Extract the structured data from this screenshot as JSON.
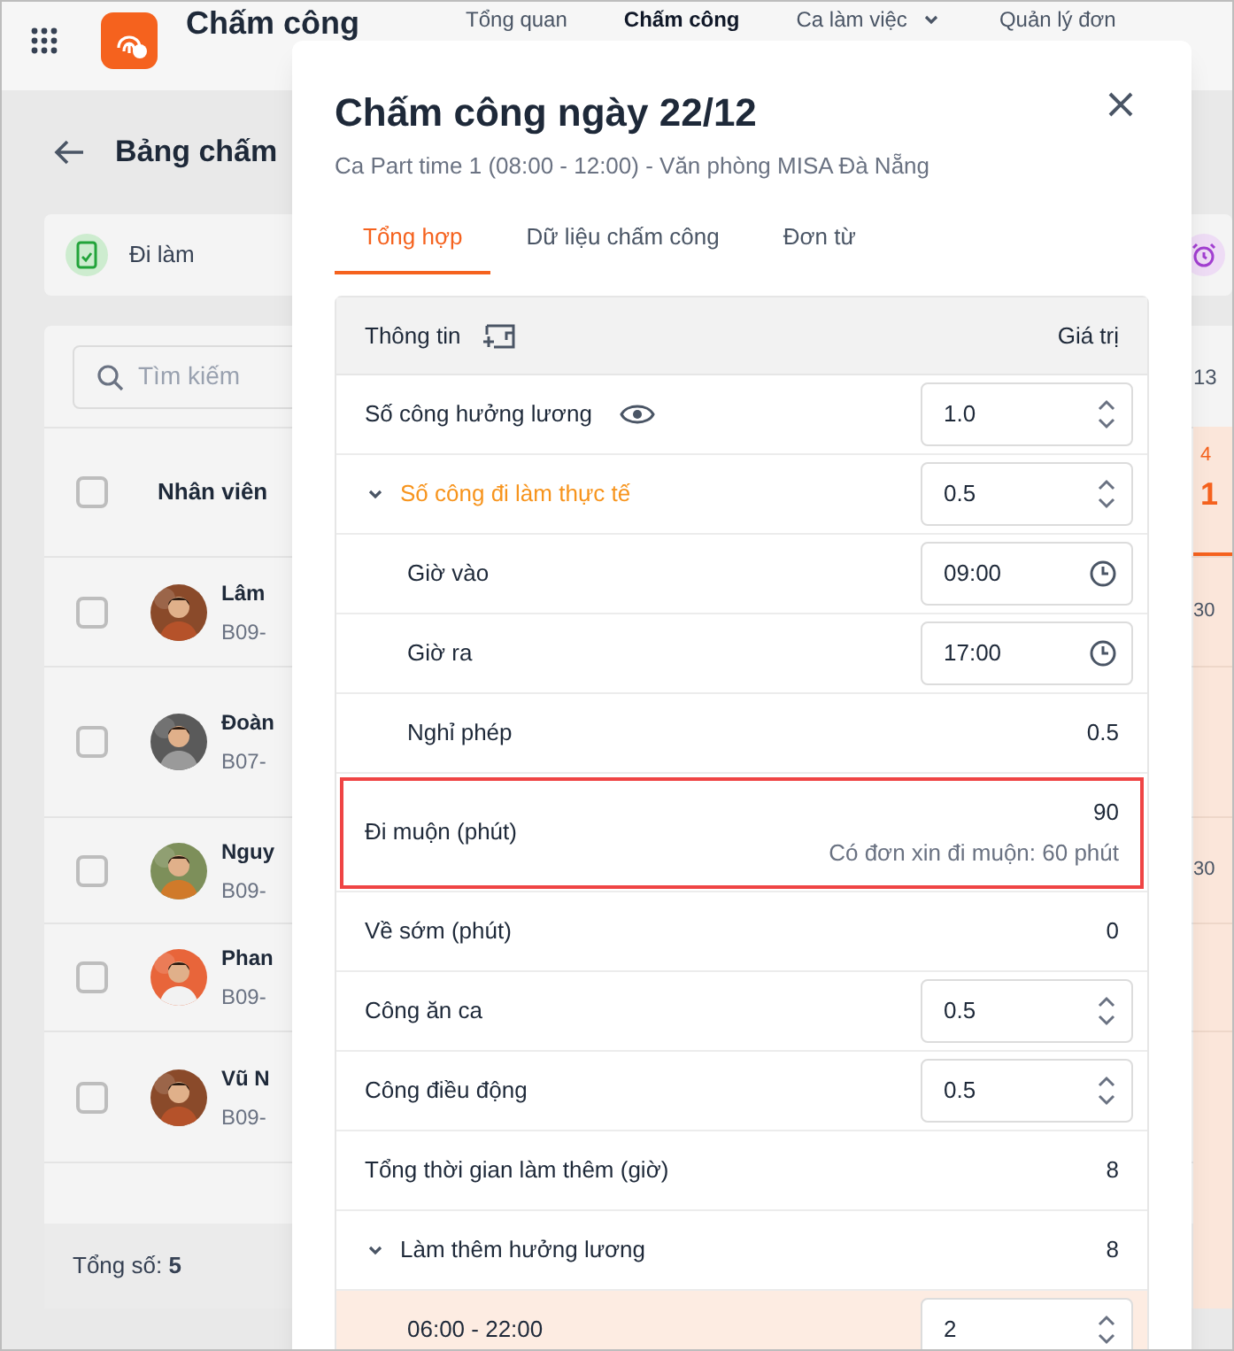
{
  "app": {
    "title": "Chấm công",
    "nav": [
      {
        "label": "Tổng quan",
        "selected": false,
        "dropdown": false
      },
      {
        "label": "Chấm công",
        "selected": true,
        "dropdown": false
      },
      {
        "label": "Ca làm việc",
        "selected": false,
        "dropdown": true
      },
      {
        "label": "Quản lý đơn",
        "selected": false,
        "dropdown": false
      }
    ]
  },
  "page": {
    "title": "Bảng chấm",
    "filter_label": "Đi làm",
    "search": {
      "placeholder": "Tìm kiếm"
    },
    "select_all_checked": false,
    "column_heading": "Nhân viên",
    "date_fragment": "13",
    "day_fragment": "4",
    "date_number_fragment": "1",
    "employees": [
      {
        "name": "Lâm",
        "code": "B09-",
        "checked": false,
        "cell": "30"
      },
      {
        "name": "Đoàn",
        "code": "B07-",
        "checked": false
      },
      {
        "name": "Nguy",
        "code": "B09-",
        "checked": false,
        "cell": "30"
      },
      {
        "name": "Phan",
        "code": "B09-",
        "checked": false
      },
      {
        "name": "Vũ N",
        "code": "B09-",
        "checked": false
      }
    ],
    "total_label": "Tổng số:",
    "total": "5"
  },
  "dialog": {
    "title": "Chấm công ngày 22/12",
    "subtitle": "Ca Part time 1 (08:00 - 12:00) - Văn phòng MISA Đà Nẵng",
    "tabs": [
      {
        "label": "Tổng hợp",
        "selected": true
      },
      {
        "label": "Dữ liệu chấm công",
        "selected": false
      },
      {
        "label": "Đơn từ",
        "selected": false
      }
    ],
    "table": {
      "columns": [
        "Thông tin",
        "Giá trị"
      ],
      "rows": [
        {
          "label": "Số công hưởng lương",
          "kind": "stepper",
          "value": "1.0",
          "visibility_toggle": true
        },
        {
          "label": "Số công đi làm thực tế",
          "kind": "stepper",
          "value": "0.5",
          "expanded": true,
          "children": [
            {
              "label": "Giờ vào",
              "kind": "time",
              "value": "09:00"
            },
            {
              "label": "Giờ ra",
              "kind": "time",
              "value": "17:00"
            },
            {
              "label": "Nghỉ phép",
              "kind": "value",
              "value": "0.5"
            }
          ]
        },
        {
          "label": "Đi muộn (phút)",
          "kind": "value",
          "value": "90",
          "note": "Có đơn xin đi muộn: 60 phút",
          "flagged": true
        },
        {
          "label": "Về sớm (phút)",
          "kind": "value",
          "value": "0"
        },
        {
          "label": "Công ăn ca",
          "kind": "stepper",
          "value": "0.5"
        },
        {
          "label": "Công điều động",
          "kind": "stepper",
          "value": "0.5"
        },
        {
          "label": "Tổng thời gian làm thêm (giờ)",
          "kind": "value",
          "value": "8"
        },
        {
          "label": "Làm thêm hưởng lương",
          "kind": "value",
          "value": "8",
          "expanded": true,
          "children": [
            {
              "label": "06:00 - 22:00",
              "kind": "stepper",
              "value": "2",
              "highlighted": true
            }
          ]
        }
      ]
    }
  }
}
